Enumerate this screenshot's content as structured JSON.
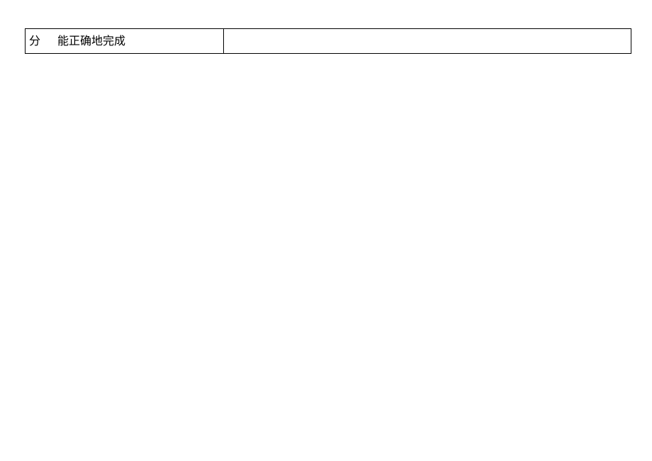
{
  "table": {
    "row1": {
      "col1": "分",
      "col2": "能正确地完成"
    }
  }
}
